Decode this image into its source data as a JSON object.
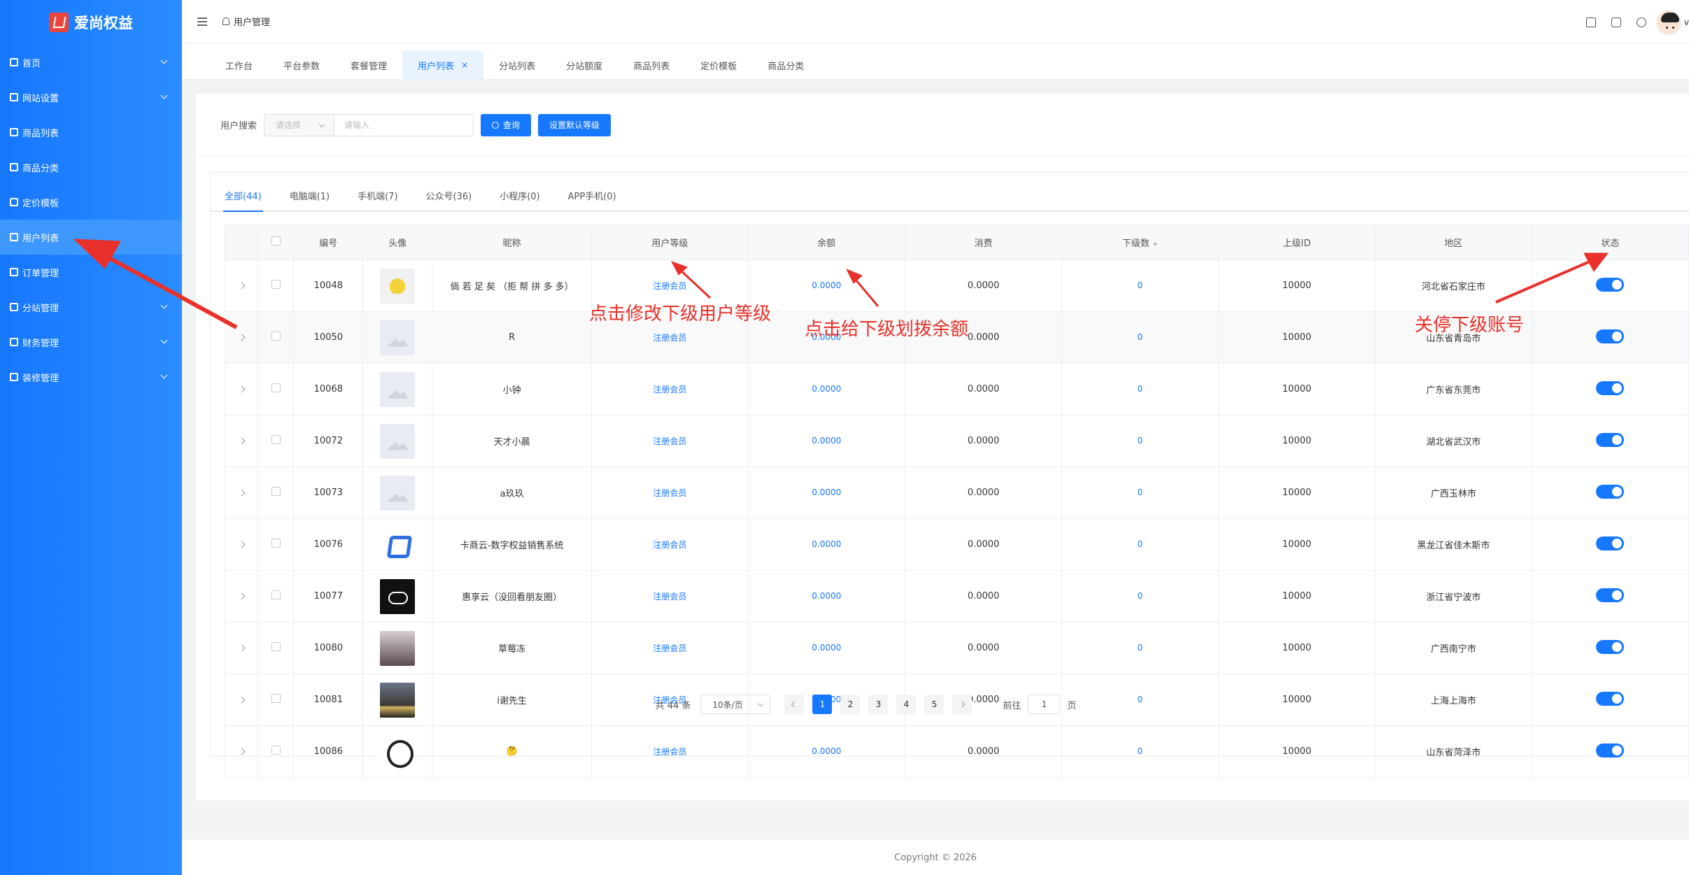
{
  "brand": {
    "name": "爱尚权益"
  },
  "sidebar": {
    "items": [
      {
        "label": "首页",
        "icon": "home-icon",
        "expandable": true
      },
      {
        "label": "网站设置",
        "icon": "settings-icon",
        "expandable": true
      },
      {
        "label": "商品列表",
        "icon": "list-icon",
        "expandable": false
      },
      {
        "label": "商品分类",
        "icon": "grid-icon",
        "expandable": false
      },
      {
        "label": "定价模板",
        "icon": "template-icon",
        "expandable": false
      },
      {
        "label": "用户列表",
        "icon": "user-icon",
        "expandable": false,
        "active": true
      },
      {
        "label": "订单管理",
        "icon": "cart-icon",
        "expandable": false
      },
      {
        "label": "分站管理",
        "icon": "station-icon",
        "expandable": true
      },
      {
        "label": "财务管理",
        "icon": "finance-icon",
        "expandable": true
      },
      {
        "label": "装修管理",
        "icon": "decor-icon",
        "expandable": true
      }
    ]
  },
  "header": {
    "breadcrumb": "用户管理",
    "avatar_tail": "v"
  },
  "tabs": [
    {
      "label": "工作台"
    },
    {
      "label": "平台参数"
    },
    {
      "label": "套餐管理"
    },
    {
      "label": "用户列表",
      "active": true
    },
    {
      "label": "分站列表"
    },
    {
      "label": "分站额度"
    },
    {
      "label": "商品列表"
    },
    {
      "label": "定价模板"
    },
    {
      "label": "商品分类"
    }
  ],
  "search": {
    "label": "用户搜索",
    "select_placeholder": "请选择",
    "input_placeholder": "请输入",
    "query_button": "查询",
    "default_level_button": "设置默认等级"
  },
  "subtabs": [
    "全部(44)",
    "电脑端(1)",
    "手机端(7)",
    "公众号(36)",
    "小程序(0)",
    "APP手机(0)"
  ],
  "table": {
    "columns": [
      "编号",
      "头像",
      "昵称",
      "用户等级",
      "余额",
      "消费",
      "下级数",
      "上级ID",
      "地区",
      "状态"
    ],
    "rows": [
      {
        "id": "10048",
        "avatar": "pikachu",
        "nickname": "倘 若 足 矣 （拒 帮 拼 多 多）",
        "level": "注册会员",
        "balance": "0.0000",
        "spend": "0.0000",
        "sub": "0",
        "parent": "10000",
        "region": "河北省石家庄市",
        "status": true
      },
      {
        "id": "10050",
        "avatar": "placeholder",
        "nickname": "R",
        "level": "注册会员",
        "balance": "0.0000",
        "spend": "0.0000",
        "sub": "0",
        "parent": "10000",
        "region": "山东省青岛市",
        "status": true
      },
      {
        "id": "10068",
        "avatar": "placeholder",
        "nickname": "小钟",
        "level": "注册会员",
        "balance": "0.0000",
        "spend": "0.0000",
        "sub": "0",
        "parent": "10000",
        "region": "广东省东莞市",
        "status": true
      },
      {
        "id": "10072",
        "avatar": "placeholder",
        "nickname": "天才小晨",
        "level": "注册会员",
        "balance": "0.0000",
        "spend": "0.0000",
        "sub": "0",
        "parent": "10000",
        "region": "湖北省武汉市",
        "status": true
      },
      {
        "id": "10073",
        "avatar": "placeholder",
        "nickname": "a玖玖",
        "level": "注册会员",
        "balance": "0.0000",
        "spend": "0.0000",
        "sub": "0",
        "parent": "10000",
        "region": "广西玉林市",
        "status": true
      },
      {
        "id": "10076",
        "avatar": "blue-logo",
        "nickname": "卡商云-数字权益销售系统",
        "level": "注册会员",
        "balance": "0.0000",
        "spend": "0.0000",
        "sub": "0",
        "parent": "10000",
        "region": "黑龙江省佳木斯市",
        "status": true
      },
      {
        "id": "10077",
        "avatar": "cloud",
        "nickname": "惠享云（没回看朋友圈）",
        "level": "注册会员",
        "balance": "0.0000",
        "spend": "0.0000",
        "sub": "0",
        "parent": "10000",
        "region": "浙江省宁波市",
        "status": true
      },
      {
        "id": "10080",
        "avatar": "girl",
        "nickname": "草莓冻",
        "level": "注册会员",
        "balance": "0.0000",
        "spend": "0.0000",
        "sub": "0",
        "parent": "10000",
        "region": "广西南宁市",
        "status": true
      },
      {
        "id": "10081",
        "avatar": "sunset",
        "nickname": "i谢先生",
        "level": "注册会员",
        "balance": "0.0000",
        "spend": "0.0000",
        "sub": "0",
        "parent": "10000",
        "region": "上海上海市",
        "status": true
      },
      {
        "id": "10086",
        "avatar": "panda",
        "nickname": "🤔",
        "level": "注册会员",
        "balance": "0.0000",
        "spend": "0.0000",
        "sub": "0",
        "parent": "10000",
        "region": "山东省菏泽市",
        "status": true
      }
    ]
  },
  "pagination": {
    "total": "共 44 条",
    "page_size": "10条/页",
    "pages": [
      "1",
      "2",
      "3",
      "4",
      "5"
    ],
    "current": "1",
    "goto_label": "前往",
    "goto_value": "1",
    "page_unit": "页"
  },
  "footer": {
    "text": "Copyright © 2026"
  },
  "annotations": {
    "level_hint": "点击修改下级用户等级",
    "balance_hint": "点击给下级划拨余额",
    "status_hint": "关停下级账号"
  },
  "colors": {
    "primary": "#1677ff",
    "annotation": "#e8312a"
  }
}
